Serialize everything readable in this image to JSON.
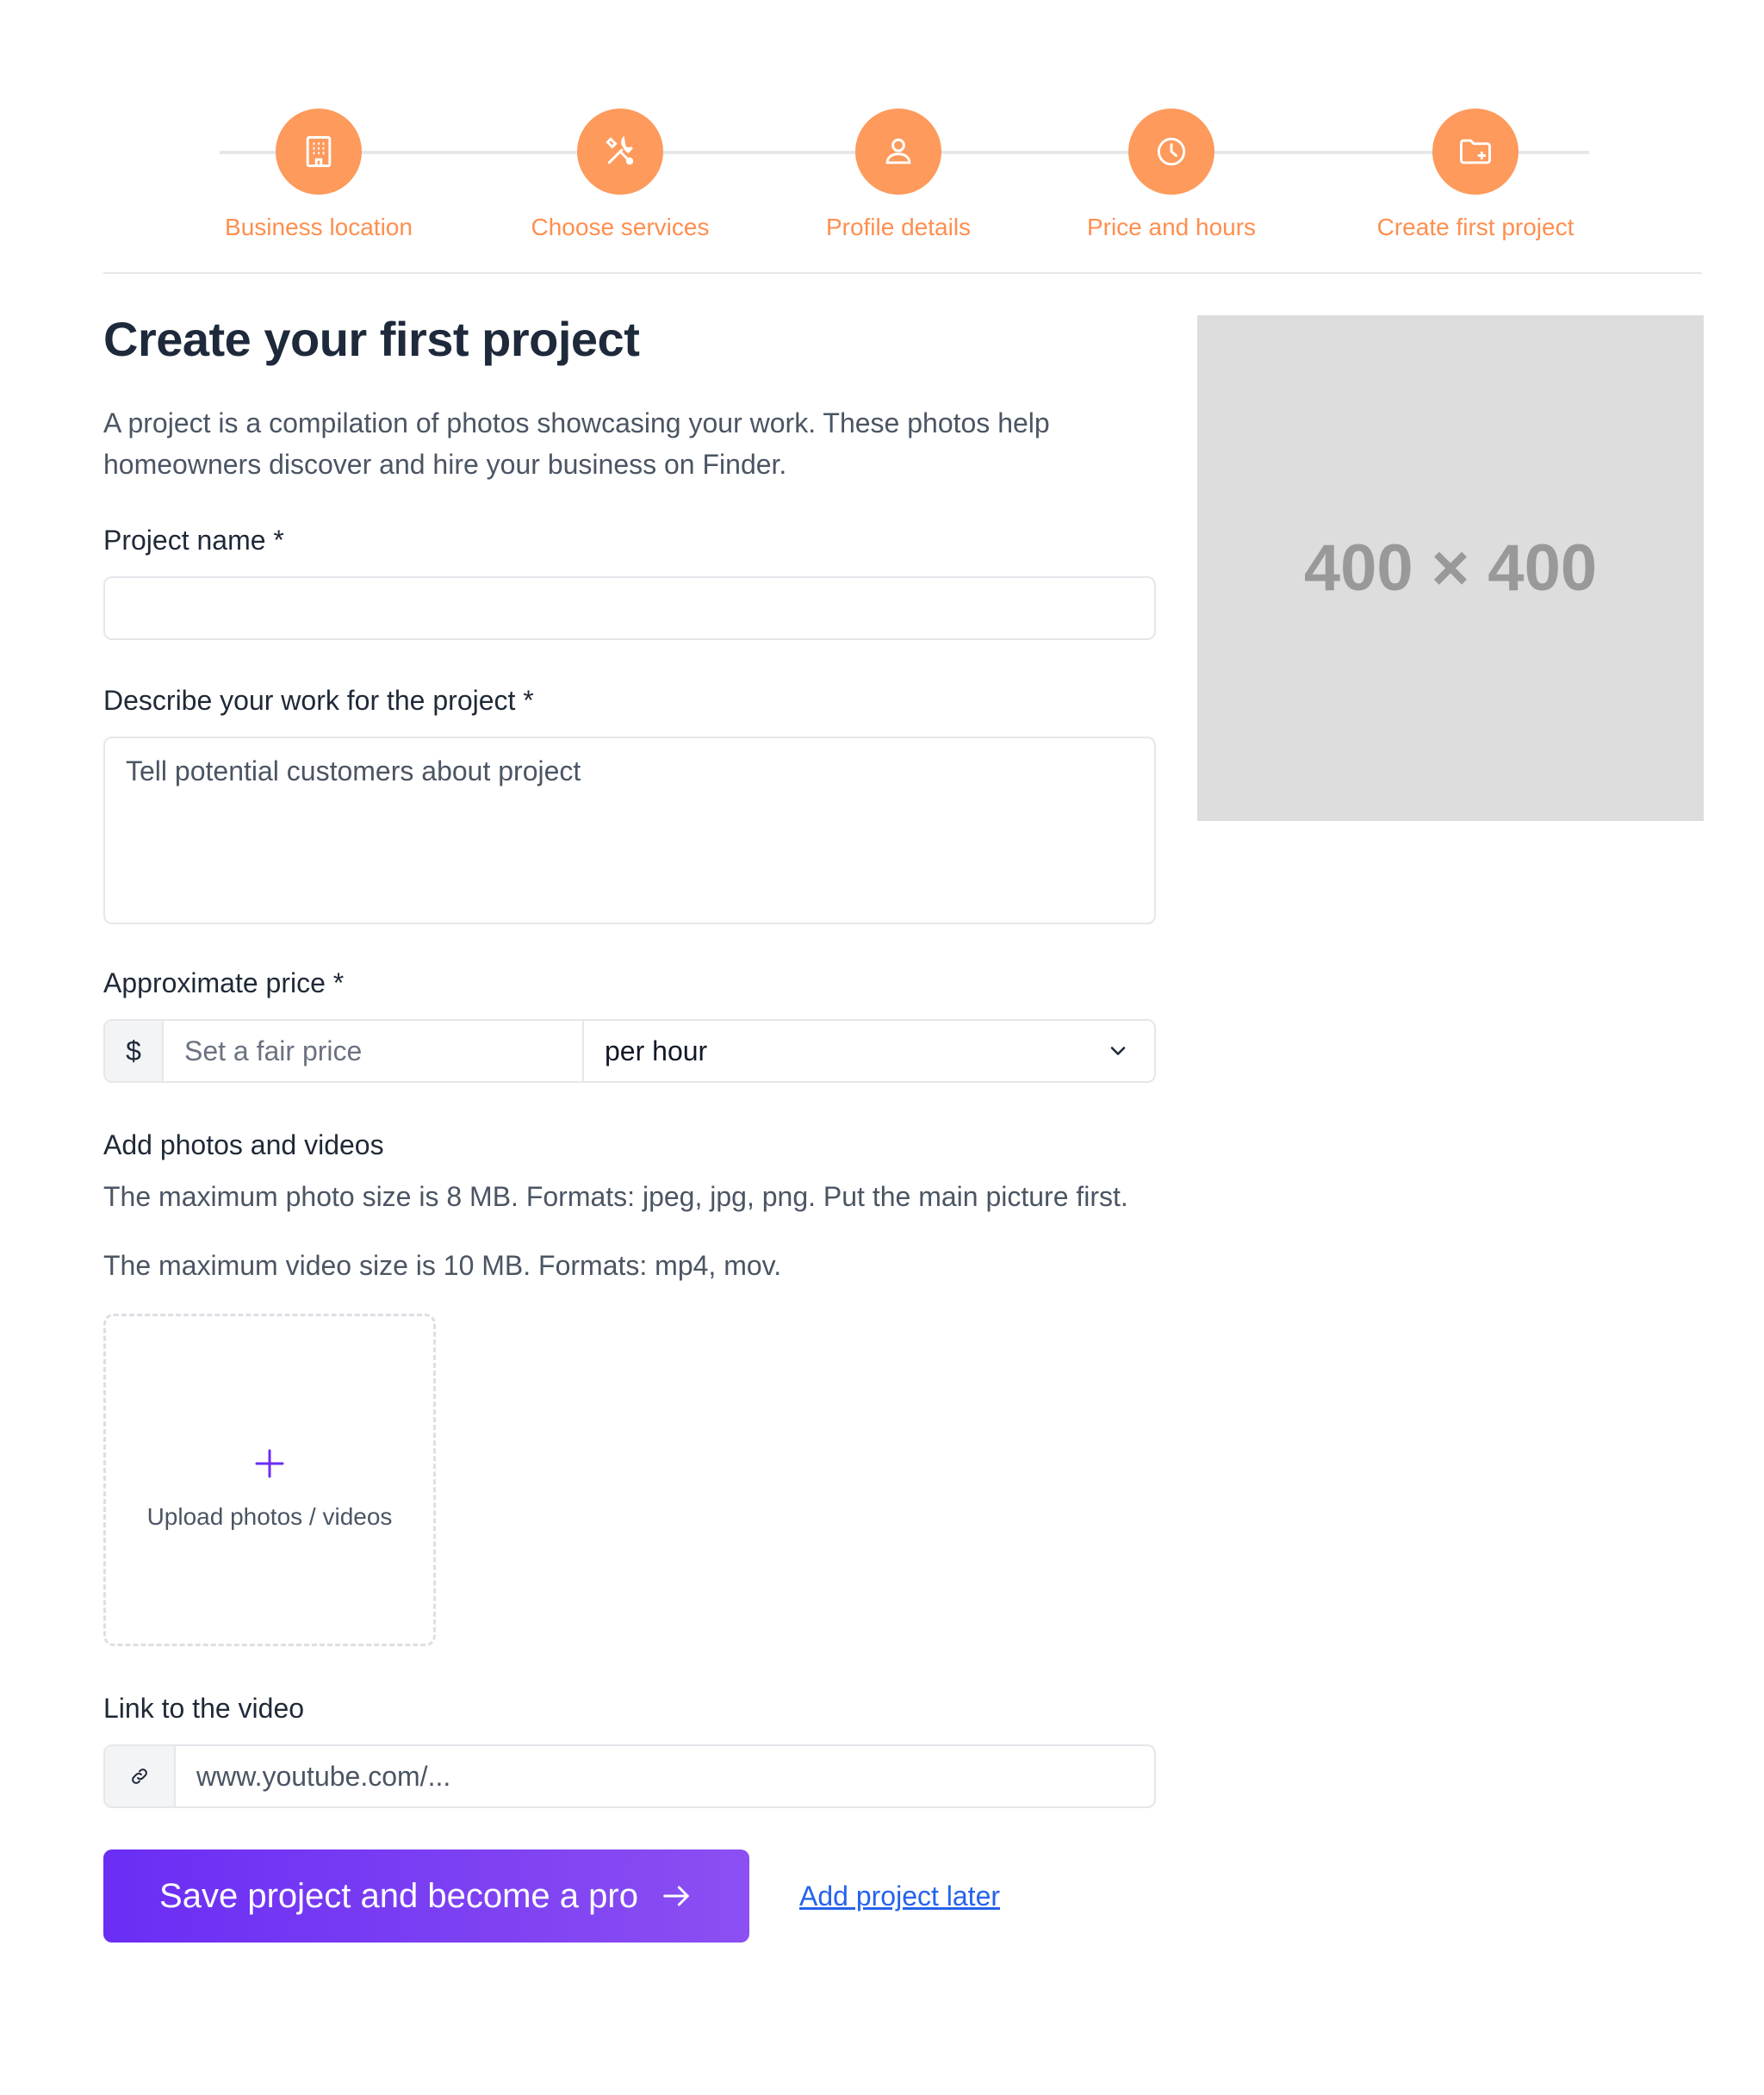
{
  "colors": {
    "step_accent": "#fd9a5c",
    "primary_button": "#6a2df4",
    "link": "#2563eb"
  },
  "steps": [
    {
      "label": "Business location",
      "icon": "building-icon"
    },
    {
      "label": "Choose services",
      "icon": "tools-icon"
    },
    {
      "label": "Profile details",
      "icon": "user-icon"
    },
    {
      "label": "Price and hours",
      "icon": "clock-icon"
    },
    {
      "label": "Create first project",
      "icon": "folder-plus-icon"
    }
  ],
  "form": {
    "title": "Create your first project",
    "description": "A project is a compilation of photos showcasing your work. These photos help homeowners discover and hire your business on Finder.",
    "project_name": {
      "label": "Project name *",
      "value": ""
    },
    "work": {
      "label": "Describe your work for the project *",
      "placeholder": "Tell potential customers about project"
    },
    "price": {
      "label": "Approximate price *",
      "currency": "$",
      "placeholder": "Set a fair price",
      "unit": "per hour"
    },
    "media": {
      "label": "Add photos and videos",
      "photo_help": "The maximum photo size is 8 MB. Formats: jpeg, jpg, png. Put the main picture first.",
      "video_help": "The maximum video size is 10 MB. Formats: mp4, mov.",
      "upload_label": "Upload photos / videos"
    },
    "video_link": {
      "label": "Link to the video",
      "placeholder": "www.youtube.com/..."
    },
    "save_label": "Save project and become a pro",
    "later_label": "Add project later"
  },
  "placeholder_image": {
    "text": "400 × 400"
  }
}
